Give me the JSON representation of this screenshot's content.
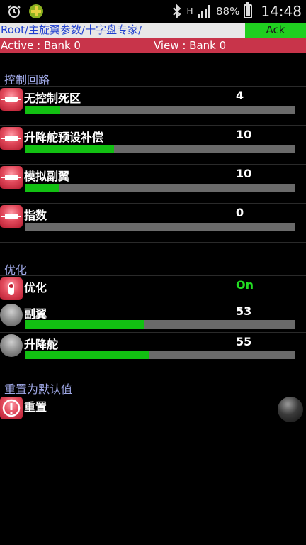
{
  "status_bar": {
    "battery": "88%",
    "time": "14:48",
    "signal_type": "H"
  },
  "path_bar": {
    "path": "Root/主旋翼参数/十字盘专家/",
    "ack_label": "Ack"
  },
  "bank_bar": {
    "active": "Active : Bank 0",
    "view": "View : Bank 0"
  },
  "sections": {
    "control_loop": {
      "title": "控制回路",
      "items": [
        {
          "label": "无控制死区",
          "value": "4",
          "fill": 0.13
        },
        {
          "label": "升降舵预设补偿",
          "value": "10",
          "fill": 0.33
        },
        {
          "label": "模拟副翼",
          "value": "10",
          "fill": 0.125
        },
        {
          "label": "指数",
          "value": "0",
          "fill": 0.0
        }
      ]
    },
    "optimize": {
      "title": "优化",
      "items": [
        {
          "label": "优化",
          "value": "On"
        },
        {
          "label": "副翼",
          "value": "53",
          "fill": 0.44
        },
        {
          "label": "升降舵",
          "value": "55",
          "fill": 0.46
        }
      ]
    },
    "reset": {
      "title": "重置为默认值",
      "items": [
        {
          "label": "重置"
        }
      ]
    }
  },
  "colors": {
    "accent_green": "#22dd22",
    "bar_fill": "#12c012",
    "bank_bar": "#c8344a",
    "section_title": "#9fa8e6"
  }
}
